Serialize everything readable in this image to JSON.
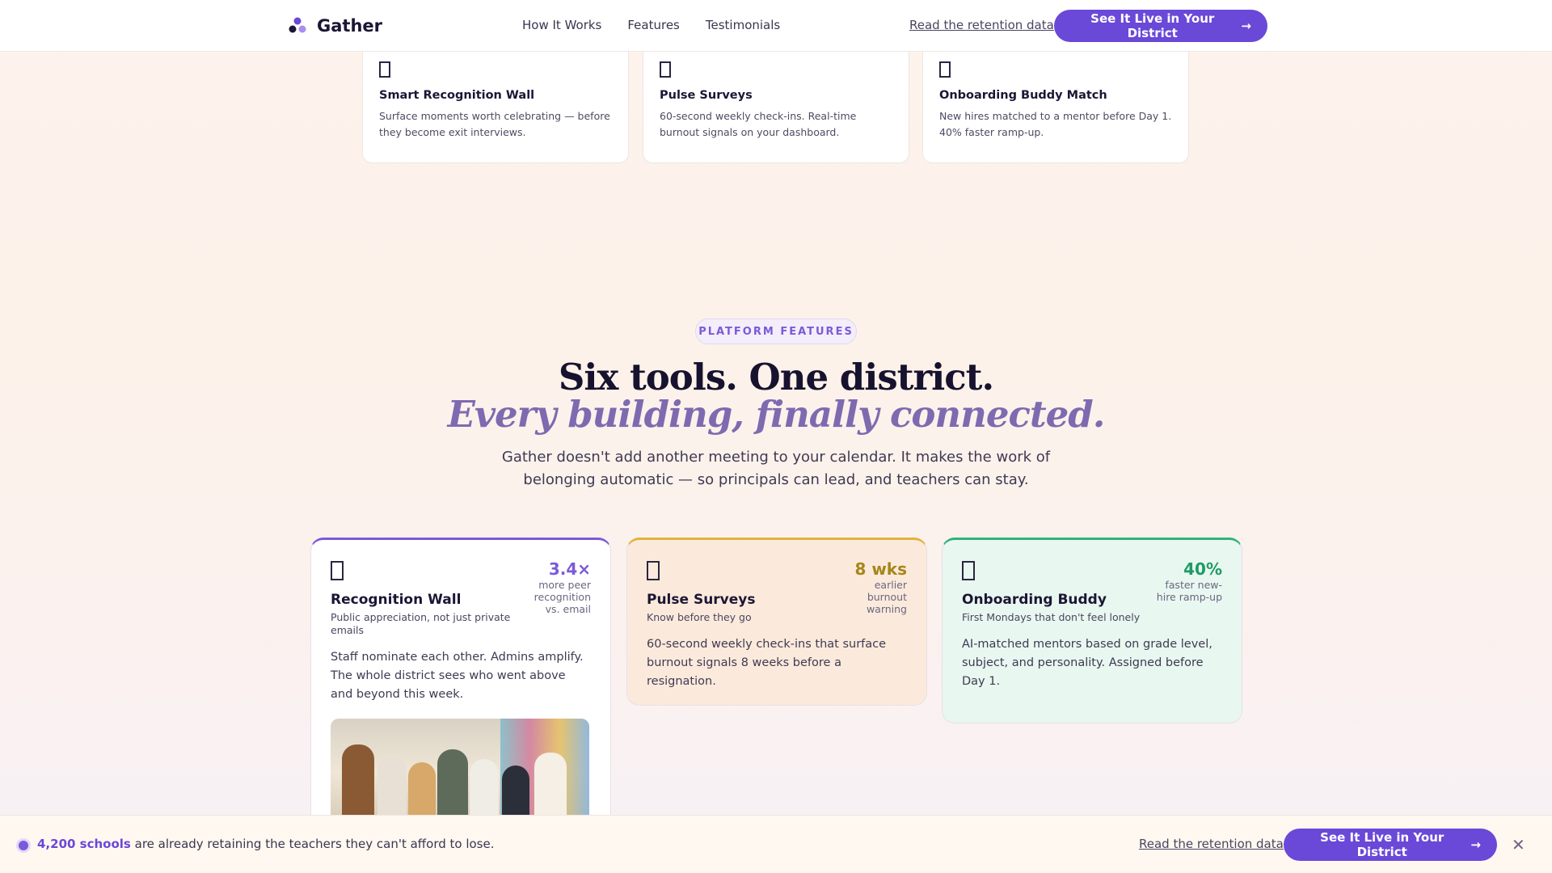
{
  "brand": {
    "name": "Gather",
    "logo_icon": "gather-logo-icon"
  },
  "nav": {
    "links": [
      "How It Works",
      "Features",
      "Testimonials"
    ],
    "retention_link": "Read the retention data",
    "cta_label": "See It Live in Your District",
    "cta_icon": "arrow-right-icon"
  },
  "mini_cards": [
    {
      "title": "Smart Recognition Wall",
      "desc": "Surface moments worth celebrating — before they become exit interviews."
    },
    {
      "title": "Pulse Surveys",
      "desc": "60-second weekly check-ins. Real-time burnout signals on your dashboard."
    },
    {
      "title": "Onboarding Buddy Match",
      "desc": "New hires matched to a mentor before Day 1. 40% faster ramp-up."
    }
  ],
  "section": {
    "eyebrow": "PLATFORM FEATURES",
    "headline": "Six tools. One district.",
    "subline": "Every building, finally connected.",
    "intro": "Gather doesn't add another meeting to your calendar. It makes the work of belonging automatic — so principals can lead, and teachers can stay."
  },
  "features": [
    {
      "title": "Recognition Wall",
      "tagline": "Public appreciation, not just private emails",
      "stat_value": "3.4×",
      "stat_note": "more peer recognition vs. email",
      "body": "Staff nominate each other. Admins amplify. The whole district sees who went above and beyond this week.",
      "accent": "#7b5ad9"
    },
    {
      "title": "Pulse Surveys",
      "tagline": "Know before they go",
      "stat_value": "8 wks",
      "stat_note": "earlier burnout warning",
      "body": "60-second weekly check-ins that surface burnout signals 8 weeks before a resignation.",
      "accent": "#a6861a"
    },
    {
      "title": "Onboarding Buddy",
      "tagline": "First Mondays that don't feel lonely",
      "stat_value": "40%",
      "stat_note": "faster new-hire ramp-up",
      "body": "AI-matched mentors based on grade level, subject, and personality. Assigned before Day 1.",
      "accent": "#1f9a66"
    }
  ],
  "bottom_bar": {
    "count": "4,200 schools",
    "text": " are already retaining the teachers they can't afford to lose.",
    "retention_link": "Read the retention data",
    "cta_label": "See It Live in Your District",
    "close_icon": "close-icon"
  }
}
